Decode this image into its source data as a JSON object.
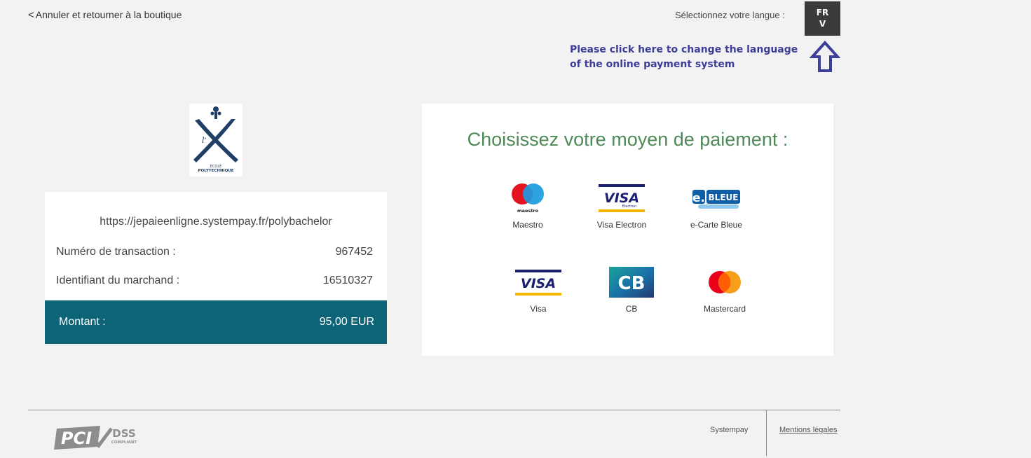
{
  "header": {
    "back_link": "Annuler et retourner à la boutique",
    "language_label": "Sélectionnez votre langue :",
    "language_code": "FR",
    "language_dropdown_glyph": "V",
    "language_hint_line1": "Please click here to change the language",
    "language_hint_line2": "of the online payment system"
  },
  "merchant": {
    "logo_text_line1": "ECOLE",
    "logo_text_line2": "POLYTECHNIQUE",
    "url": "https://jepaieenligne.systempay.fr/polybachelor",
    "transaction_label": "Numéro de transaction :",
    "transaction_value": "967452",
    "merchant_id_label": "Identifiant du marchand :",
    "merchant_id_value": "16510327",
    "amount_label": "Montant :",
    "amount_value": "95,00 EUR"
  },
  "payment": {
    "title": "Choisissez votre moyen de paiement :",
    "methods": [
      {
        "label": "Maestro",
        "icon": "maestro-icon",
        "logo_text": "maestro"
      },
      {
        "label": "Visa Electron",
        "icon": "visa-electron-icon",
        "logo_text": "VISA",
        "logo_subtext": "Electron"
      },
      {
        "label": "e-Carte Bleue",
        "icon": "e-carte-bleue-icon",
        "logo_text": "e.",
        "logo_subtext": "BLEUE"
      },
      {
        "label": "Visa",
        "icon": "visa-icon",
        "logo_text": "VISA"
      },
      {
        "label": "CB",
        "icon": "cb-icon",
        "logo_text": "CB"
      },
      {
        "label": "Mastercard",
        "icon": "mastercard-icon"
      }
    ]
  },
  "footer": {
    "pci_text": "PCI",
    "pci_dss": "DSS",
    "pci_compliant": "COMPLIANT",
    "systempay": "Systempay",
    "legal": "Mentions légales"
  },
  "colors": {
    "accent_teal": "#0e6477",
    "title_green": "#4e8a57",
    "hint_blue": "#3d3d9a",
    "logo_navy": "#1f3f66"
  }
}
